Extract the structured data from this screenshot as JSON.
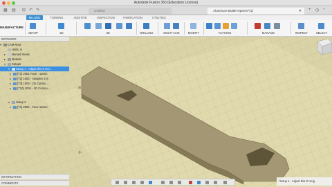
{
  "window": {
    "title": "Autodesk Fusion 360 (Education License)"
  },
  "tabs": {
    "untitled": "Untitled",
    "active": "Aluminum-Bottle-Opener*(1)"
  },
  "ribbon_tabs": [
    "MILLING",
    "TURNING",
    "ADDITIVE",
    "INSPECTION",
    "FABRICATION",
    "UTILITIES"
  ],
  "toolbar": {
    "workspace": "MANUFACTURE",
    "setup": "SETUP",
    "g2d": "2D",
    "g3d": "3D",
    "drilling": "DRILLING",
    "multiaxis": "MULTI-AXIS",
    "modify": "MODIFY",
    "actions": "ACTIONS",
    "manage": "MANAGE",
    "inspect": "INSPECT",
    "select": "SELECT"
  },
  "browser": {
    "header": "BROWSER",
    "items": [
      "CAM Root",
      "Units: in",
      "Named Views",
      "Models",
      "Setups",
      "Setup 1 - Adjust this Z-Hei...",
      "[T1] 2001 Face - 12mm",
      "[T2] 1002 - Adaptive 1-8",
      "[T3] 1003 - 2D Contou...",
      "[T10] 1004 - 2D Contou...",
      "Setup 2",
      "[T1] 2001 - Face 12mm"
    ]
  },
  "bottom": {
    "comments": "COMMENTS",
    "info": "INFORMATION"
  },
  "status": "Setup 1 - Adjust this Z-Heig"
}
